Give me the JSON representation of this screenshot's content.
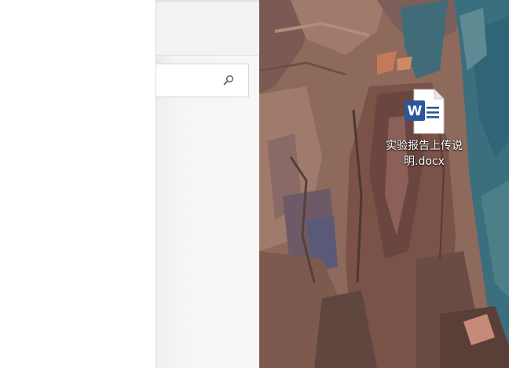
{
  "explorer": {
    "search_icon": "search-icon"
  },
  "desktop": {
    "items": [
      {
        "label": "实验报告上传说明.docx",
        "icon": "word-document-icon",
        "icon_letter": "W",
        "icon_color": "#2b579a"
      }
    ]
  }
}
